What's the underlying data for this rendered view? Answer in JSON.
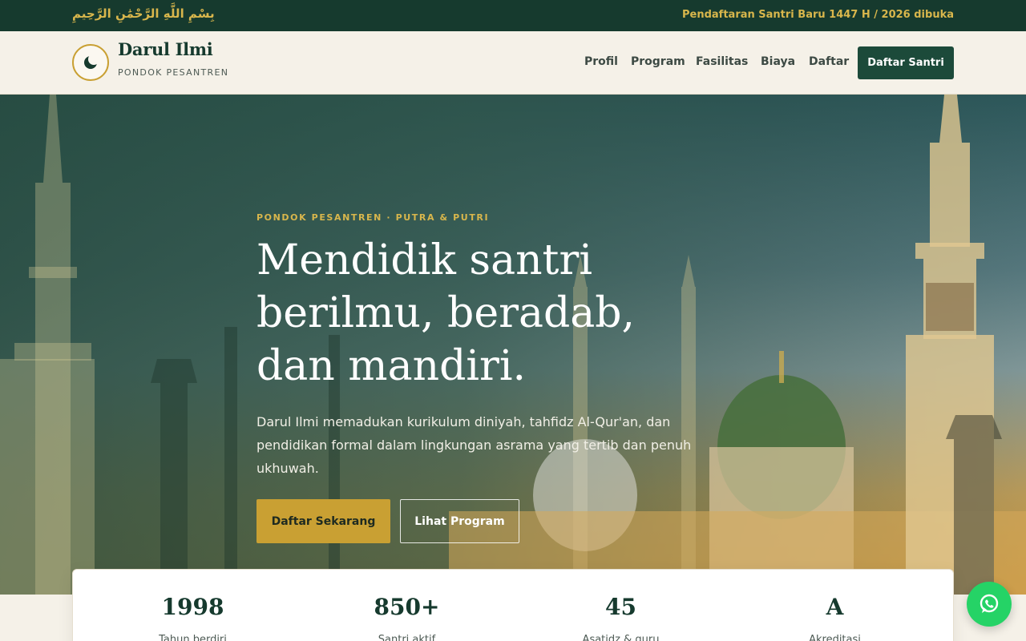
{
  "topbar": {
    "basmala": "بِسْمِ اللَّهِ الرَّحْمَٰنِ الرَّحِيمِ",
    "announcement": "Pendaftaran Santri Baru 1447 H / 2026 dibuka"
  },
  "header": {
    "brand_name": "Darul Ilmi",
    "brand_sub": "PONDOK PESANTREN",
    "nav": [
      "Profil",
      "Program",
      "Fasilitas",
      "Biaya",
      "Daftar"
    ],
    "cta": "Daftar Santri"
  },
  "hero": {
    "eyebrow": "PONDOK PESANTREN · PUTRA & PUTRI",
    "title": "Mendidik santri berilmu, beradab, dan mandiri.",
    "description": "Darul Ilmi memadukan kurikulum diniyah, tahfidz Al-Qur'an, dan pendidikan formal dalam lingkungan asrama yang tertib dan penuh ukhuwah.",
    "primary_button": "Daftar Sekarang",
    "secondary_button": "Lihat Program"
  },
  "stats": [
    {
      "value": "1998",
      "label": "Tahun berdiri"
    },
    {
      "value": "850+",
      "label": "Santri aktif"
    },
    {
      "value": "45",
      "label": "Asatidz & guru"
    },
    {
      "value": "A",
      "label": "Akreditasi"
    }
  ],
  "colors": {
    "primary_dark": "#163a2e",
    "gold": "#c9a033",
    "cream": "#f5f1e8",
    "whatsapp": "#25d366"
  },
  "icons": {
    "logo": "crescent-moon-icon",
    "float_button": "whatsapp-icon"
  }
}
